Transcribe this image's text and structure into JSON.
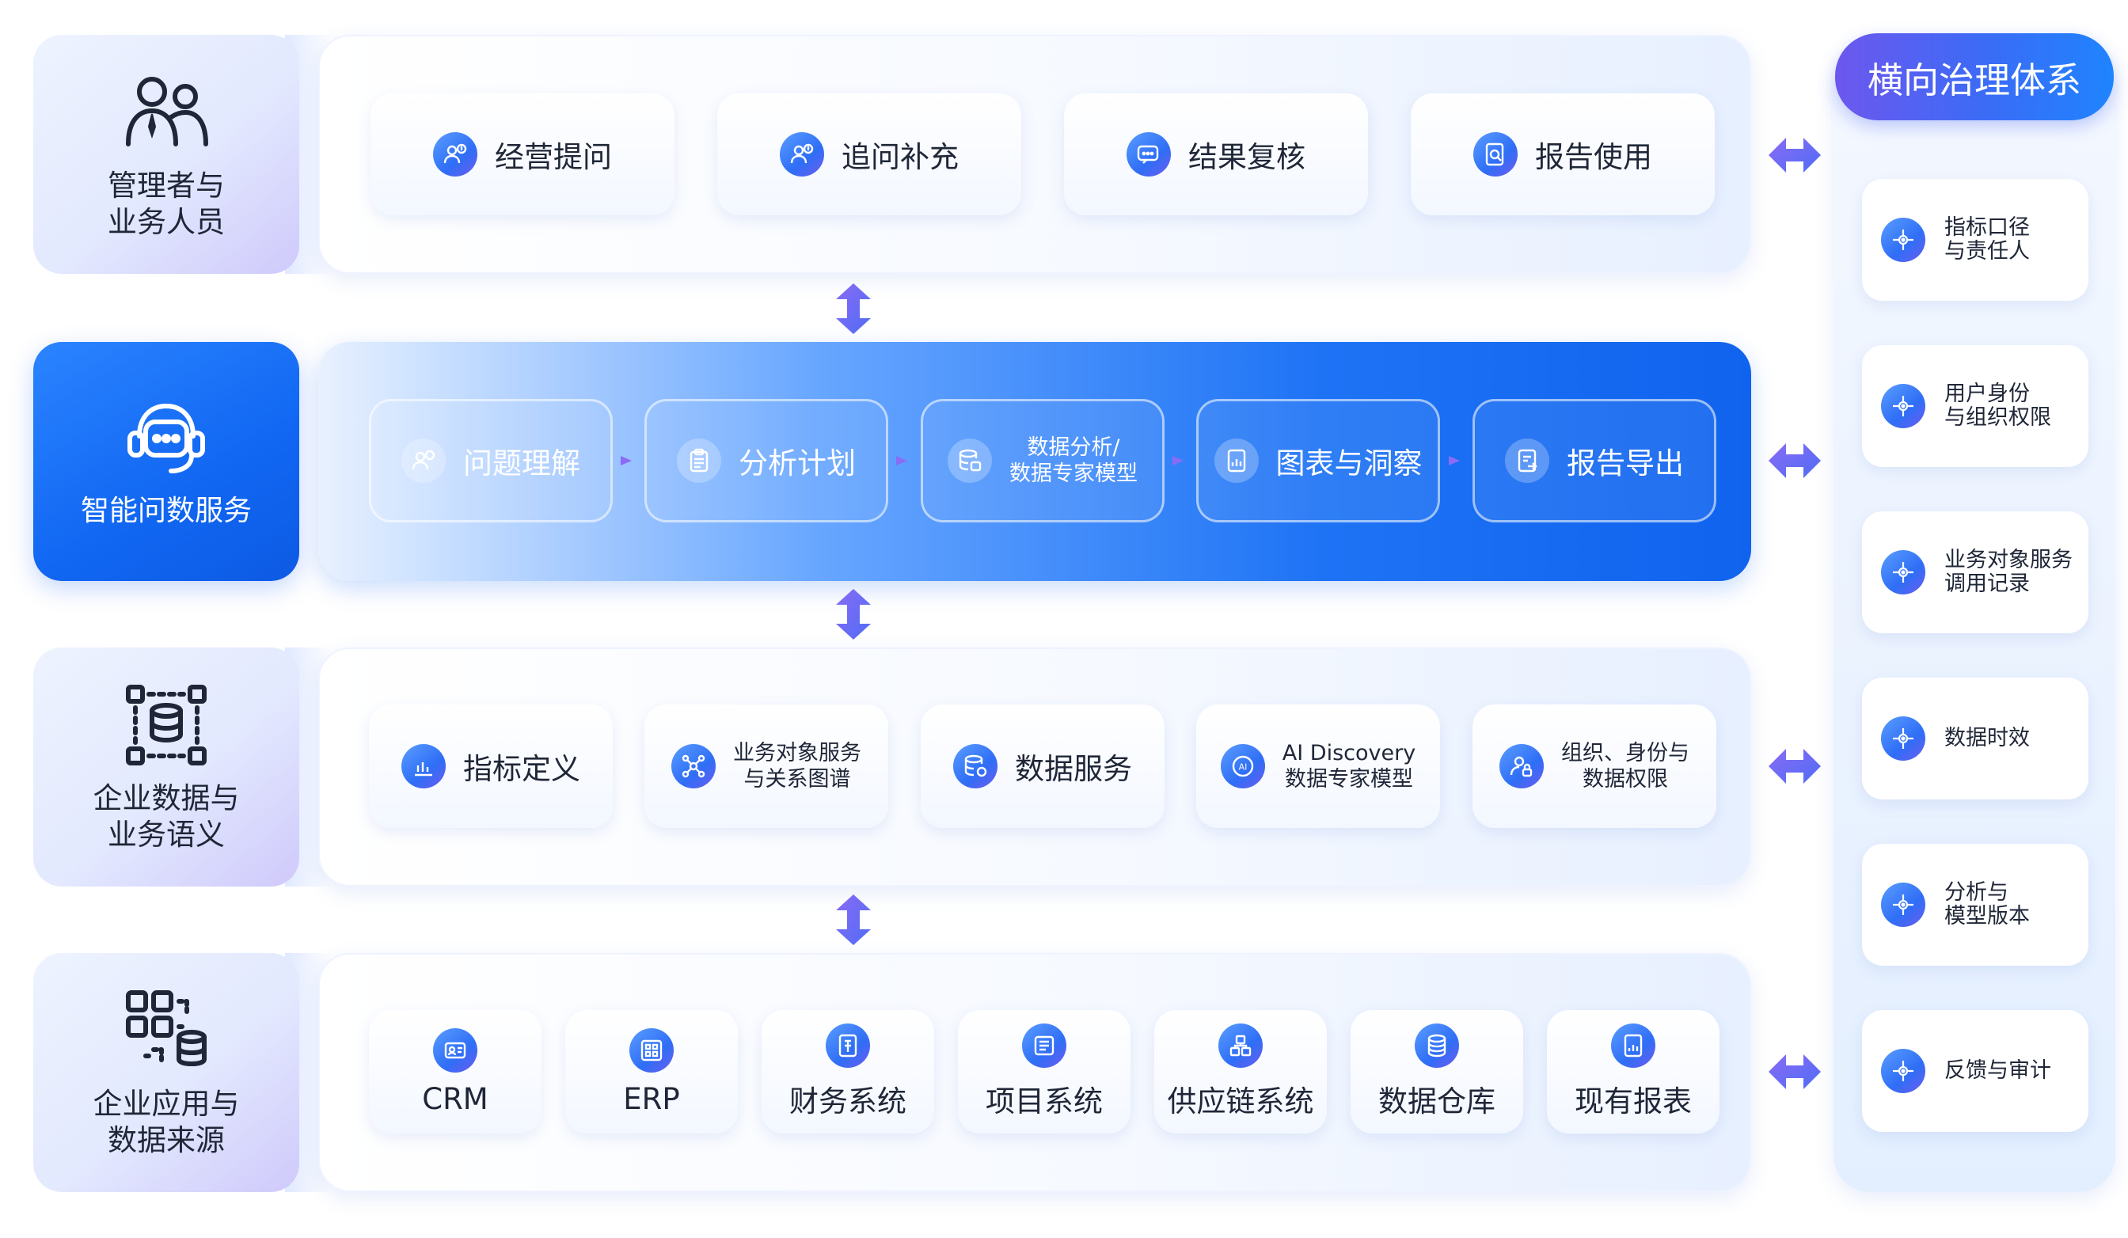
{
  "rows": [
    {
      "role": "管理者与\n业务人员",
      "role_icon": "users-icon",
      "cards": [
        "经营提问",
        "追问补充",
        "结果复核",
        "报告使用"
      ]
    },
    {
      "role": "智能问数服务",
      "role_icon": "chat-bot-icon",
      "cards": [
        "问题理解",
        "分析计划",
        "数据分析/\n数据专家模型",
        "图表与洞察",
        "报告导出"
      ]
    },
    {
      "role": "企业数据与\n业务语义",
      "role_icon": "data-network-icon",
      "cards": [
        "指标定义",
        "业务对象服务\n与关系图谱",
        "数据服务",
        "AI Discovery\n数据专家模型",
        "组织、身份与\n数据权限"
      ]
    },
    {
      "role": "企业应用与\n数据来源",
      "role_icon": "app-grid-icon",
      "cards": [
        "CRM",
        "ERP",
        "财务系统",
        "项目系统",
        "供应链系统",
        "数据仓库",
        "现有报表"
      ]
    }
  ],
  "governance": {
    "title": "横向治理体系",
    "items": [
      "指标口径\n与责任人",
      "用户身份\n与组织权限",
      "业务对象服务\n调用记录",
      "数据时效",
      "分析与\n模型版本",
      "反馈与审计"
    ]
  },
  "colors": {
    "accent": "#1167f2",
    "arrow": "#6d5ef0",
    "title_grad_start": "#6d57ee"
  }
}
